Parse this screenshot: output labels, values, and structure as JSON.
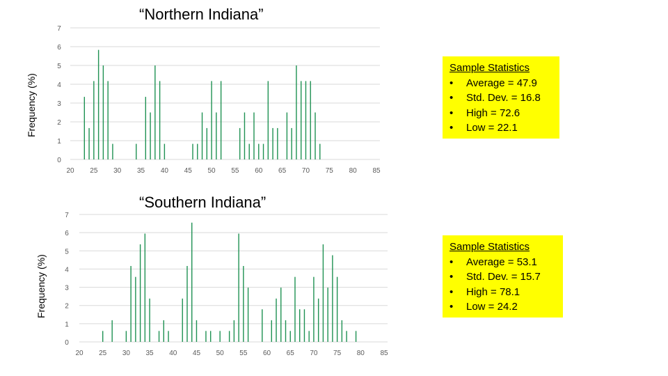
{
  "chart_data": [
    {
      "type": "bar",
      "title": "“Northern Indiana”",
      "xlabel": "",
      "ylabel": "Frequency (%)",
      "xlim": [
        20,
        85
      ],
      "ylim": [
        0,
        7
      ],
      "xticks": [
        "20",
        "25",
        "30",
        "35",
        "40",
        "45",
        "50",
        "55",
        "60",
        "65",
        "70",
        "75",
        "80",
        "85"
      ],
      "yticks": [
        "0",
        "1",
        "2",
        "3",
        "4",
        "5",
        "6",
        "7"
      ],
      "grid": true,
      "bar_color": "#1e9152",
      "x": [
        23,
        24,
        25,
        26,
        27,
        28,
        29,
        34,
        36,
        37,
        38,
        39,
        40,
        46,
        47,
        48,
        49,
        50,
        51,
        52,
        56,
        57,
        58,
        59,
        60,
        61,
        62,
        63,
        64,
        66,
        67,
        68,
        69,
        70,
        71,
        72,
        73
      ],
      "values": [
        3.33,
        1.67,
        4.17,
        5.83,
        5.0,
        4.17,
        0.83,
        0.83,
        3.33,
        2.5,
        5.0,
        4.17,
        0.83,
        0.83,
        0.83,
        2.5,
        1.67,
        4.17,
        2.5,
        4.17,
        1.67,
        2.5,
        0.83,
        2.5,
        0.83,
        0.83,
        4.17,
        1.67,
        1.67,
        2.5,
        1.67,
        5.0,
        4.17,
        4.17,
        4.17,
        2.5,
        0.83
      ]
    },
    {
      "type": "bar",
      "title": "“Southern Indiana”",
      "xlabel": "",
      "ylabel": "Frequency (%)",
      "xlim": [
        20,
        85
      ],
      "ylim": [
        0,
        7
      ],
      "xticks": [
        "20",
        "25",
        "30",
        "35",
        "40",
        "45",
        "50",
        "55",
        "60",
        "65",
        "70",
        "75",
        "80",
        "85"
      ],
      "yticks": [
        "0",
        "1",
        "2",
        "3",
        "4",
        "5",
        "6",
        "7"
      ],
      "grid": true,
      "bar_color": "#1e9152",
      "x": [
        25,
        27,
        30,
        31,
        32,
        33,
        34,
        35,
        37,
        38,
        39,
        42,
        43,
        44,
        45,
        47,
        48,
        50,
        52,
        53,
        54,
        55,
        56,
        59,
        61,
        62,
        63,
        64,
        65,
        66,
        67,
        68,
        69,
        70,
        71,
        72,
        73,
        74,
        75,
        76,
        77,
        79
      ],
      "values": [
        0.6,
        1.19,
        0.6,
        4.17,
        3.57,
        5.36,
        5.95,
        2.38,
        0.6,
        1.19,
        0.6,
        2.38,
        4.17,
        6.55,
        1.19,
        0.6,
        0.6,
        0.6,
        0.6,
        1.19,
        5.95,
        4.17,
        2.98,
        1.79,
        1.19,
        2.38,
        2.98,
        1.19,
        0.6,
        3.57,
        1.79,
        1.79,
        0.6,
        3.57,
        2.38,
        5.36,
        2.98,
        4.76,
        3.57,
        1.19,
        0.6,
        0.6
      ]
    }
  ],
  "stats": [
    {
      "heading": "Sample Statistics",
      "items": [
        "Average = 47.9",
        "Std. Dev. = 16.8",
        "High = 72.6",
        "Low = 22.1"
      ]
    },
    {
      "heading": "Sample Statistics",
      "items": [
        "Average = 53.1",
        "Std. Dev. = 15.7",
        "High = 78.1",
        "Low = 24.2"
      ]
    }
  ],
  "bullet": "•",
  "highlight_color": "#ffff00"
}
